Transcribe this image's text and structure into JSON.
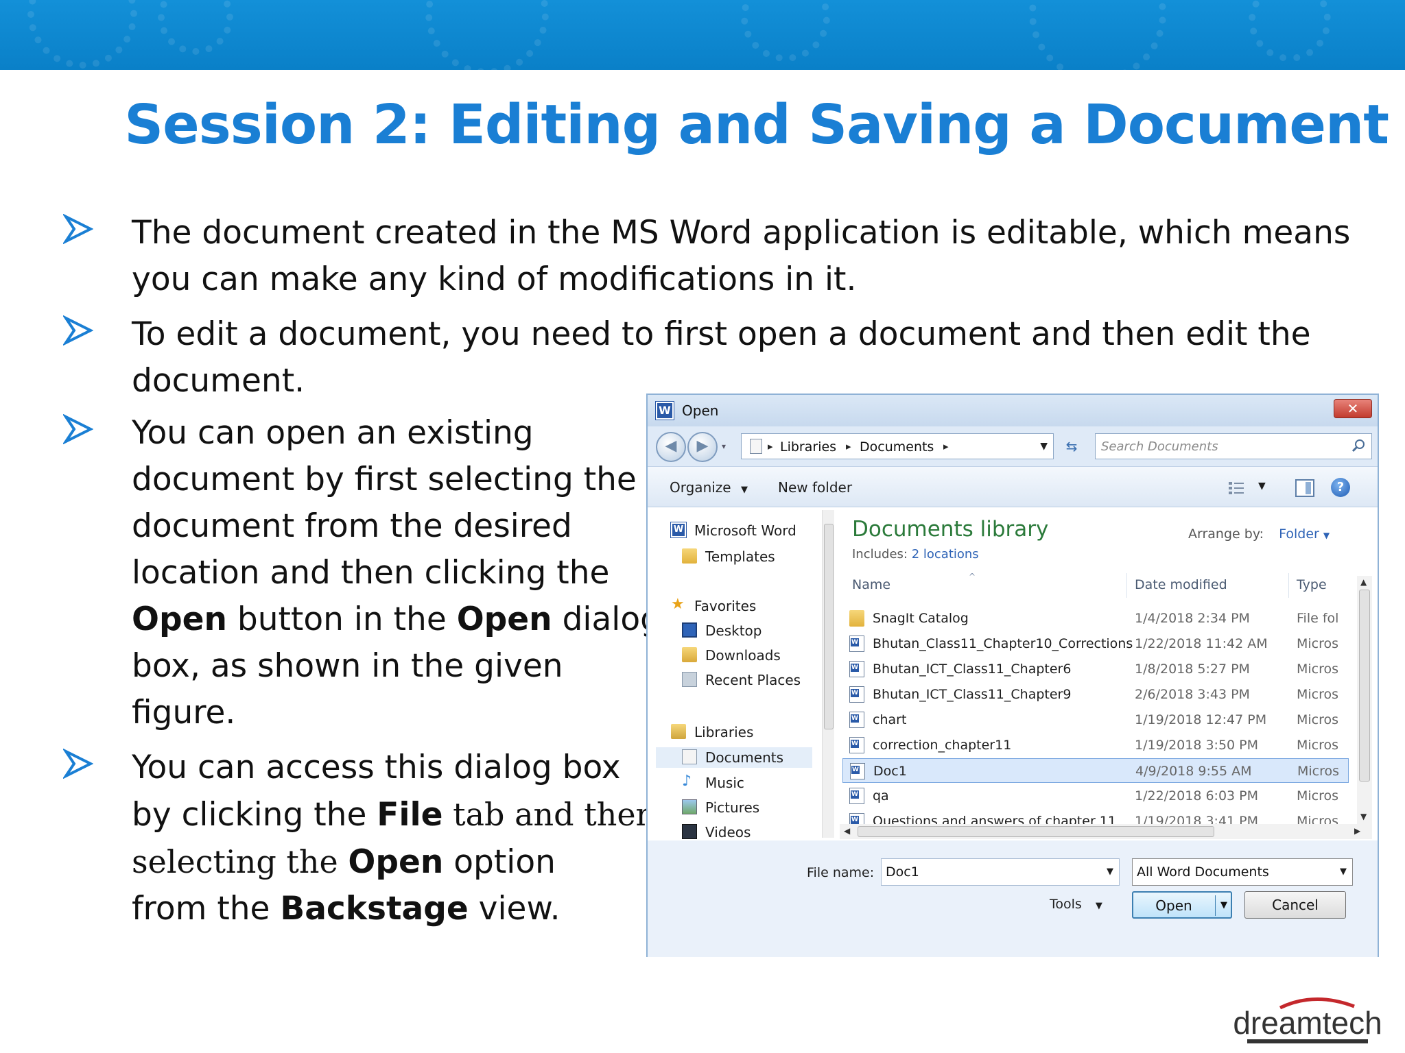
{
  "slide": {
    "title": "Session 2: Editing and Saving a Document",
    "bullets": [
      {
        "line1": "The document created in the MS Word application is editable, which means",
        "line2": "you can make any kind of modifications in it."
      },
      {
        "line1": "To edit a document, you need to first open a document and then edit the",
        "line2": "document."
      },
      {
        "l1": "You can open an existing",
        "l2": "document by first selecting the",
        "l3": "document from the desired",
        "l4": "location and then clicking the",
        "l5_b1": "Open",
        "l5_t1": " button in the ",
        "l5_b2": "Open",
        "l5_t2": " dialog",
        "l6": "box, as shown in the given",
        "l7": "figure."
      },
      {
        "l1": "You can access this dialog box",
        "l2_t1": "by clicking the ",
        "l2_b1": "File",
        "l2_t2": " tab and then",
        "l3_t1": "selecting the ",
        "l3_b1": "Open",
        "l3_t2": " option",
        "l4_t1": "from the ",
        "l4_b1": "Backstage",
        "l4_t2": " view."
      }
    ],
    "logo_text": "dreamtech",
    "colors": {
      "banner": "#0a86cf",
      "title": "#1a7fd4",
      "bullet_arrow": "#1a7fd4"
    }
  },
  "dialog": {
    "title": "Open",
    "app_icon": "W",
    "close_icon": "✕",
    "address": {
      "crumbs": [
        "Libraries",
        "Documents"
      ]
    },
    "search_placeholder": "Search Documents",
    "toolbar": {
      "organize": "Organize",
      "new_folder": "New folder"
    },
    "nav": {
      "word": "Microsoft Word",
      "templates": "Templates",
      "favorites": "Favorites",
      "desktop": "Desktop",
      "downloads": "Downloads",
      "recent": "Recent Places",
      "libraries": "Libraries",
      "documents": "Documents",
      "music": "Music",
      "pictures": "Pictures",
      "videos": "Videos"
    },
    "library": {
      "title": "Documents library",
      "includes_label": "Includes:",
      "includes_link": "2 locations",
      "arrange_label": "Arrange by:",
      "arrange_value": "Folder"
    },
    "columns": {
      "name": "Name",
      "date": "Date modified",
      "type": "Type"
    },
    "files": [
      {
        "name": "SnagIt Catalog",
        "date": "1/4/2018 2:34 PM",
        "type": "File fol",
        "kind": "folder"
      },
      {
        "name": "Bhutan_Class11_Chapter10_Corrections",
        "date": "1/22/2018 11:42 AM",
        "type": "Micros",
        "kind": "word"
      },
      {
        "name": "Bhutan_ICT_Class11_Chapter6",
        "date": "1/8/2018 5:27 PM",
        "type": "Micros",
        "kind": "word"
      },
      {
        "name": "Bhutan_ICT_Class11_Chapter9",
        "date": "2/6/2018 3:43 PM",
        "type": "Micros",
        "kind": "word"
      },
      {
        "name": "chart",
        "date": "1/19/2018 12:47 PM",
        "type": "Micros",
        "kind": "word"
      },
      {
        "name": "correction_chapter11",
        "date": "1/19/2018 3:50 PM",
        "type": "Micros",
        "kind": "word"
      },
      {
        "name": "Doc1",
        "date": "4/9/2018 9:55 AM",
        "type": "Micros",
        "kind": "word"
      },
      {
        "name": "qa",
        "date": "1/22/2018 6:03 PM",
        "type": "Micros",
        "kind": "word"
      },
      {
        "name": "Questions and answers of chapter 11",
        "date": "1/19/2018 3:41 PM",
        "type": "Micros",
        "kind": "word"
      }
    ],
    "footer": {
      "file_name_label": "File name:",
      "file_name_value": "Doc1",
      "filter_value": "All Word Documents",
      "tools": "Tools",
      "open": "Open",
      "cancel": "Cancel"
    }
  }
}
